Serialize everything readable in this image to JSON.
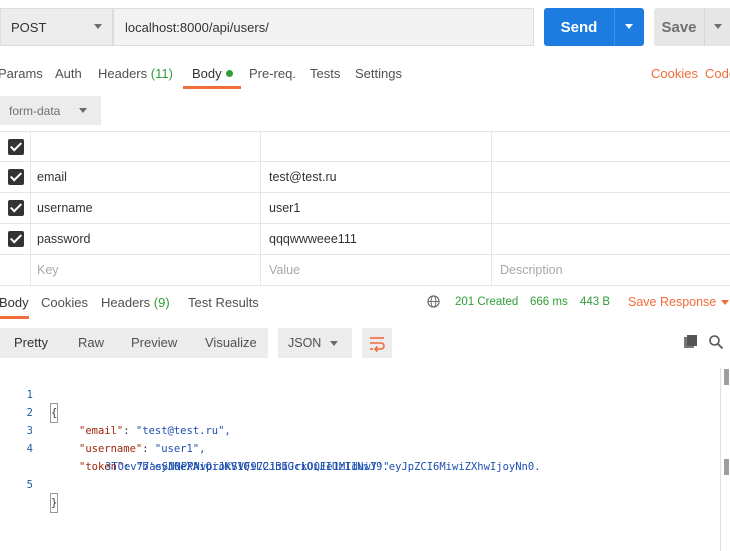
{
  "request": {
    "method": "POST",
    "url": "localhost:8000/api/users/",
    "send_label": "Send",
    "save_label": "Save"
  },
  "request_tabs": {
    "params": "Params",
    "auth": "Auth",
    "headers": "Headers",
    "headers_count": "(11)",
    "body": "Body",
    "prereq": "Pre-req.",
    "tests": "Tests",
    "settings": "Settings",
    "cookies": "Cookies",
    "code": "Code"
  },
  "body_type": "form-data",
  "form_rows": [
    {
      "key": "",
      "value": "",
      "description": "",
      "checked": true
    },
    {
      "key": "email",
      "value": "test@test.ru",
      "description": "",
      "checked": true
    },
    {
      "key": "username",
      "value": "user1",
      "description": "",
      "checked": true
    },
    {
      "key": "password",
      "value": "qqqwwweee111",
      "description": "",
      "checked": true
    }
  ],
  "placeholders": {
    "key": "Key",
    "value": "Value",
    "description": "Description"
  },
  "response_tabs": {
    "body": "Body",
    "cookies": "Cookies",
    "headers": "Headers",
    "headers_count": "(9)",
    "test_results": "Test Results"
  },
  "response_status": {
    "status": "201 Created",
    "time": "666 ms",
    "size": "443 B",
    "save_response": "Save Response"
  },
  "view_modes": [
    "Pretty",
    "Raw",
    "Preview",
    "Visualize"
  ],
  "format": "JSON",
  "code_lines": {
    "l1": {
      "num": "1",
      "text": "{"
    },
    "l2": {
      "num": "2",
      "key": "\"email\"",
      "value": "\"test@test.ru\","
    },
    "l3": {
      "num": "3",
      "key": "\"username\"",
      "value": "\"user1\","
    },
    "l4": {
      "num": "4",
      "key": "\"token\"",
      "value": "\"b'eyJ0eXAiOiJKV1QiLCJhbGciOiJIUzI1NiJ9.eyJpZCI6MiwiZXhwIjoyNn0."
    },
    "l4b": {
      "value": "3TOev77asSNNPPNvprokSVF972i3IJrkOQEe1MIduwY'\""
    },
    "l5": {
      "num": "5",
      "text": "}"
    }
  },
  "colors": {
    "accent_blue": "#1c7ce0",
    "accent_orange": "#f26b3a",
    "success_green": "#2e9e36"
  }
}
